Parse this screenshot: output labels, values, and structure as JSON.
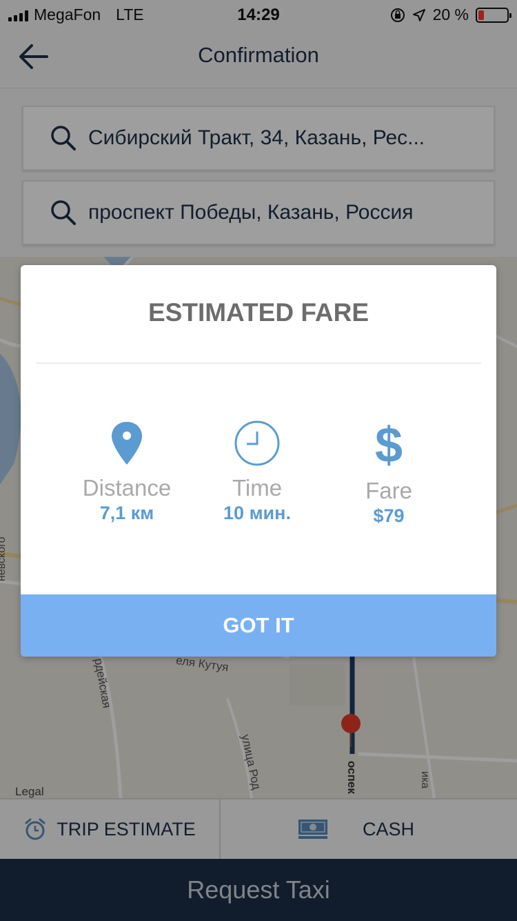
{
  "status_bar": {
    "carrier": "MegaFon",
    "network": "LTE",
    "time": "14:29",
    "battery": "20 %",
    "battery_level": 0.2
  },
  "nav": {
    "title": "Confirmation"
  },
  "search": {
    "pickup": "Сибирский Тракт, 34, Казань, Рес...",
    "dropoff": "проспект Победы, Казань, Россия"
  },
  "map": {
    "legal": "Legal",
    "streets": [
      "невского",
      "рдейская",
      "еля Кутуя",
      "улица Род",
      "оспек",
      "ика"
    ]
  },
  "modal": {
    "title": "ESTIMATED FARE",
    "stats": [
      {
        "label": "Distance",
        "value": "7,1 км",
        "icon": "location-pin-icon"
      },
      {
        "label": "Time",
        "value": "10 мин.",
        "icon": "clock-icon"
      },
      {
        "label": "Fare",
        "value": "$79",
        "icon": "dollar-icon"
      }
    ],
    "button": "GOT IT"
  },
  "bottom": {
    "trip_estimate": "TRIP ESTIMATE",
    "payment": "CASH"
  },
  "request_button": "Request Taxi",
  "colors": {
    "accent": "#78b0f2",
    "value_blue": "#5a9bd2",
    "navy": "#1c2f48",
    "battery_low": "#ff3b30"
  }
}
